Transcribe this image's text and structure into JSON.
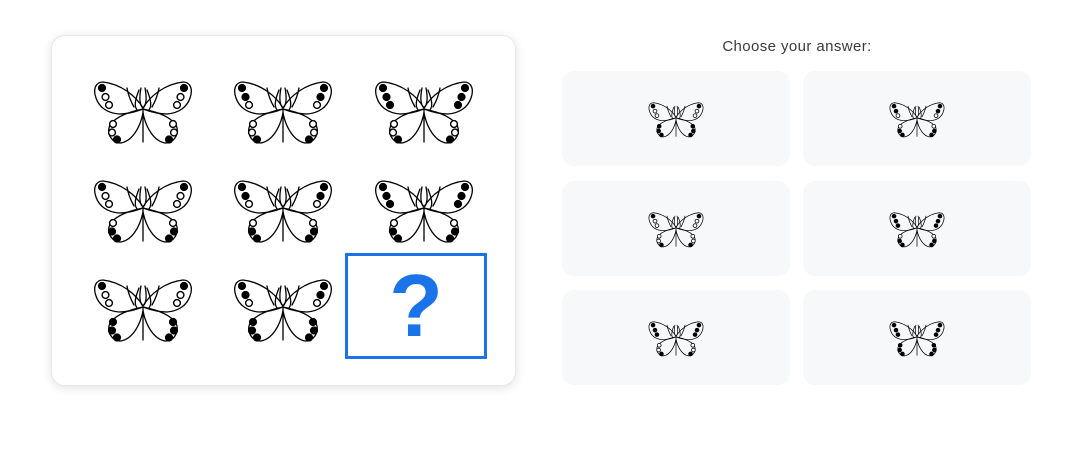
{
  "puzzle": {
    "missing_symbol": "?",
    "accent_color": "#1a73e8",
    "grid": [
      {
        "icon": "butterfly-icon",
        "wing_dots": {
          "upper": [
            "filled",
            "open",
            "open"
          ],
          "lower": [
            "open",
            "open",
            "filled"
          ]
        }
      },
      {
        "icon": "butterfly-icon",
        "wing_dots": {
          "upper": [
            "filled",
            "filled",
            "open"
          ],
          "lower": [
            "open",
            "open",
            "filled"
          ]
        }
      },
      {
        "icon": "butterfly-icon",
        "wing_dots": {
          "upper": [
            "filled",
            "filled",
            "filled"
          ],
          "lower": [
            "open",
            "open",
            "filled"
          ]
        }
      },
      {
        "icon": "butterfly-icon",
        "wing_dots": {
          "upper": [
            "filled",
            "open",
            "open"
          ],
          "lower": [
            "open",
            "filled",
            "filled"
          ]
        }
      },
      {
        "icon": "butterfly-icon",
        "wing_dots": {
          "upper": [
            "filled",
            "filled",
            "open"
          ],
          "lower": [
            "open",
            "filled",
            "filled"
          ]
        }
      },
      {
        "icon": "butterfly-icon",
        "wing_dots": {
          "upper": [
            "filled",
            "filled",
            "filled"
          ],
          "lower": [
            "open",
            "filled",
            "filled"
          ]
        }
      },
      {
        "icon": "butterfly-icon",
        "wing_dots": {
          "upper": [
            "filled",
            "open",
            "open"
          ],
          "lower": [
            "filled",
            "filled",
            "filled"
          ]
        }
      },
      {
        "icon": "butterfly-icon",
        "wing_dots": {
          "upper": [
            "filled",
            "filled",
            "open"
          ],
          "lower": [
            "filled",
            "filled",
            "filled"
          ]
        }
      }
    ]
  },
  "answers": {
    "prompt": "Choose your answer:",
    "options": [
      {
        "icon": "butterfly-icon",
        "wing_dots": {
          "upper": [
            "filled",
            "open",
            "open"
          ],
          "lower": [
            "filled",
            "filled",
            "filled"
          ]
        }
      },
      {
        "icon": "butterfly-icon",
        "wing_dots": {
          "upper": [
            "filled",
            "filled",
            "open"
          ],
          "lower": [
            "open",
            "filled",
            "filled"
          ]
        }
      },
      {
        "icon": "butterfly-icon",
        "wing_dots": {
          "upper": [
            "filled",
            "open",
            "open"
          ],
          "lower": [
            "open",
            "open",
            "filled"
          ]
        }
      },
      {
        "icon": "butterfly-icon",
        "wing_dots": {
          "upper": [
            "filled",
            "filled",
            "filled"
          ],
          "lower": [
            "open",
            "filled",
            "filled"
          ]
        }
      },
      {
        "icon": "butterfly-icon",
        "wing_dots": {
          "upper": [
            "filled",
            "filled",
            "filled"
          ],
          "lower": [
            "open",
            "open",
            "filled"
          ]
        }
      },
      {
        "icon": "butterfly-icon",
        "wing_dots": {
          "upper": [
            "filled",
            "filled",
            "filled"
          ],
          "lower": [
            "filled",
            "filled",
            "filled"
          ]
        }
      }
    ]
  }
}
